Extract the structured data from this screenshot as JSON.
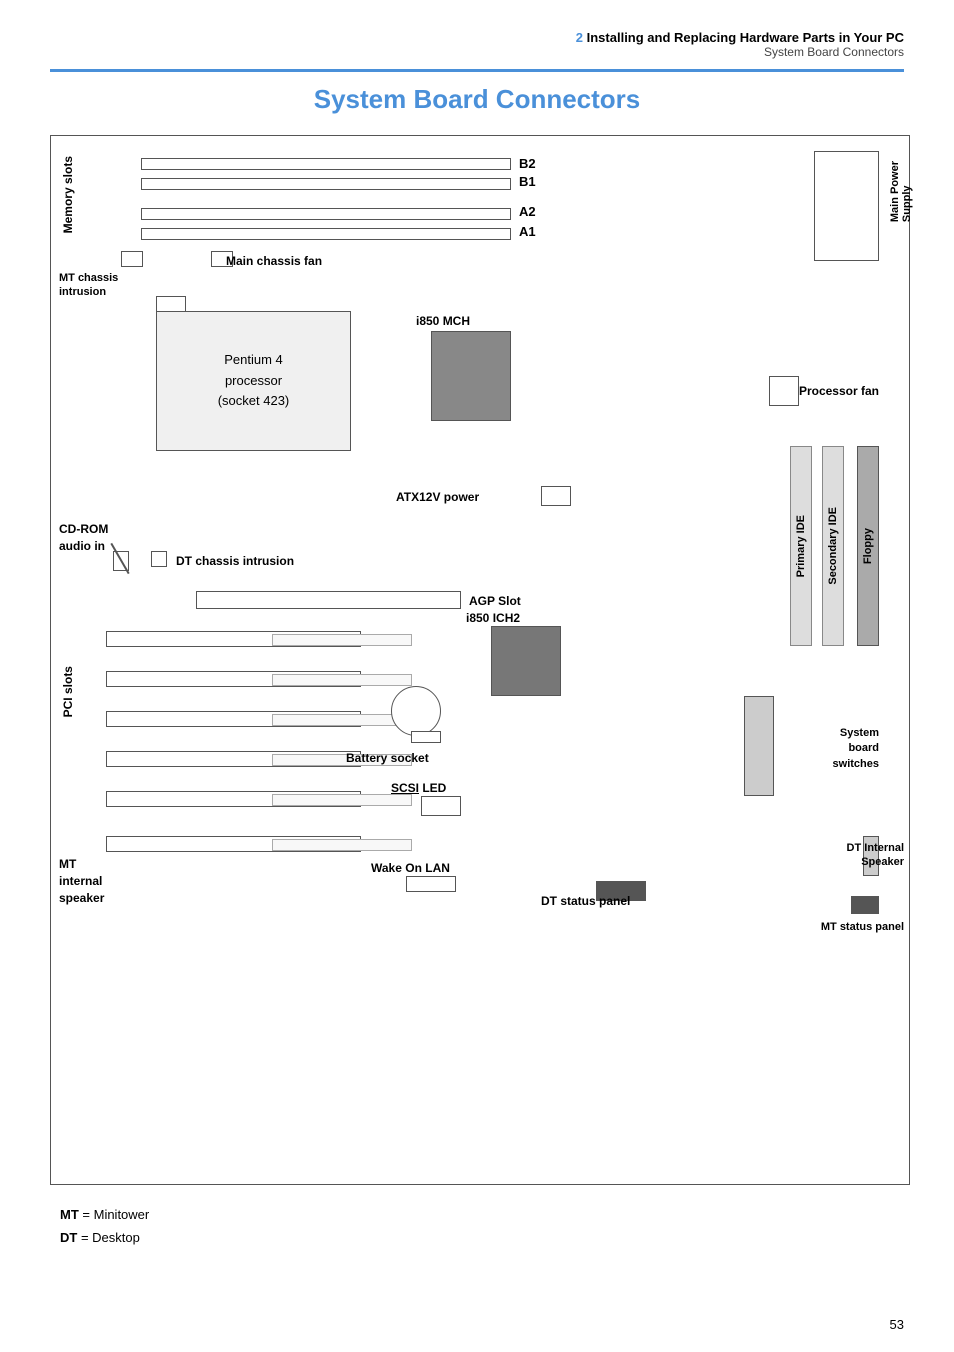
{
  "header": {
    "chapter": "2",
    "chapter_title": "Installing and Replacing Hardware Parts in Your PC",
    "sub_title": "System Board Connectors"
  },
  "section": {
    "title": "System Board Connectors"
  },
  "components": {
    "memory_slots_label": "Memory slots",
    "slot_b2": "B2",
    "slot_b1": "B1",
    "slot_a2": "A2",
    "slot_a1": "A1",
    "main_power_supply": "Main Power\nSupply",
    "mt_chassis_intrusion": "MT chassis\nintrusion",
    "main_chassis_fan": "Main chassis fan",
    "processor": "Pentium 4\nprocessor\n(socket 423)",
    "i850_mch": "i850 MCH",
    "processor_fan": "Processor fan",
    "floppy": "Floppy",
    "secondary_ide": "Secondary IDE",
    "primary_ide": "Primary IDE",
    "atx12v_power": "ATX12V power",
    "cdrom_audio_in": "CD-ROM\naudio in",
    "dt_chassis_intrusion": "DT chassis intrusion",
    "agp_slot": "AGP Slot",
    "i850_ich2": "i850 ICH2",
    "pci_slots": "PCI slots",
    "battery_socket": "Battery socket",
    "system_board_switches": "System\nboard\nswitches",
    "scsi_led": "SCSI LED",
    "mt_internal_speaker": "MT\ninternal\nspeaker",
    "wake_on_lan": "Wake On LAN",
    "dt_status_panel": "DT status panel",
    "dt_internal_speaker": "DT Internal\nSpeaker",
    "mt_status_panel": "MT status panel"
  },
  "legend": {
    "mt_line": "MT = Minitower",
    "dt_line": "DT = Desktop"
  },
  "page_number": "53"
}
